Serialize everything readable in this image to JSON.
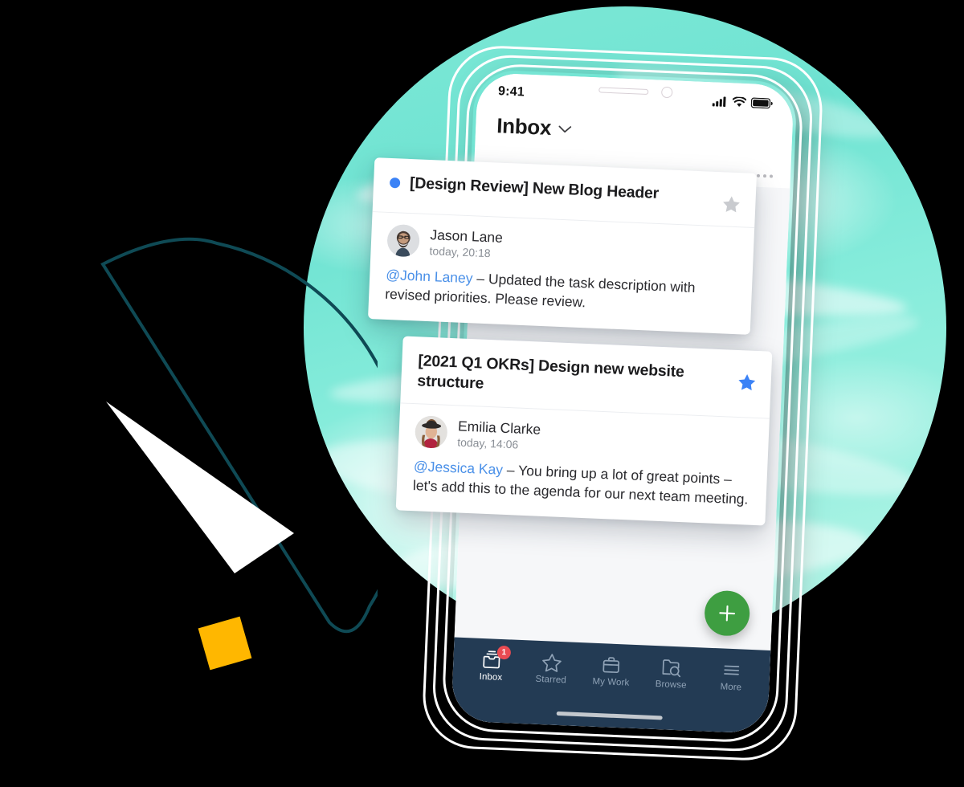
{
  "scene": {
    "background_color": "#000000",
    "circle_color": "#7EE8D6",
    "accent_yellow": "#FFB700",
    "wedge_stroke": "#0F4A55"
  },
  "decor": {
    "wedge_name": "arc-wedge-outline",
    "triangle_name": "white-triangle",
    "square_name": "yellow-square",
    "circle_name": "teal-watercolor-circle"
  },
  "phone": {
    "status_bar": {
      "time": "9:41",
      "signal_icon": "cellular-signal-icon",
      "wifi_icon": "wifi-icon",
      "battery_icon": "battery-icon"
    },
    "header": {
      "title": "Inbox",
      "chevron_icon": "chevron-down-icon",
      "overflow_icon": "more-horizontal-icon"
    },
    "fab": {
      "icon": "plus-icon",
      "color": "#3E9E41",
      "label": "Create"
    },
    "tabs": [
      {
        "label": "Inbox",
        "icon": "inbox-tray-icon",
        "active": true,
        "badge": "1"
      },
      {
        "label": "Starred",
        "icon": "star-outline-icon",
        "active": false,
        "badge": ""
      },
      {
        "label": "My Work",
        "icon": "briefcase-icon",
        "active": false,
        "badge": ""
      },
      {
        "label": "Browse",
        "icon": "folder-search-icon",
        "active": false,
        "badge": ""
      },
      {
        "label": "More",
        "icon": "hamburger-icon",
        "active": false,
        "badge": ""
      }
    ],
    "tab_bar_color": "#233B54",
    "badge_color": "#E94B52"
  },
  "cards": [
    {
      "id": "design-review",
      "unread": true,
      "title": "[Design Review] New Blog Header",
      "starred": false,
      "star_icon": "star-filled-icon",
      "star_color": "#C9CBCF",
      "author": "Jason Lane",
      "avatar": "avatar-jason-lane",
      "timestamp": "today, 20:18",
      "mention": "@John Laney",
      "message": " – Updated the task description with revised priorities. Please review."
    },
    {
      "id": "okrs",
      "unread": false,
      "title": "[2021 Q1 OKRs] Design new website structure",
      "starred": true,
      "star_icon": "star-filled-icon",
      "star_color": "#3B82F6",
      "author": "Emilia Clarke",
      "avatar": "avatar-emilia-clarke",
      "timestamp": "today, 14:06",
      "mention": "@Jessica Kay",
      "message": " – You bring up a lot of great points – let's add this to the agenda for our next team meeting."
    }
  ]
}
